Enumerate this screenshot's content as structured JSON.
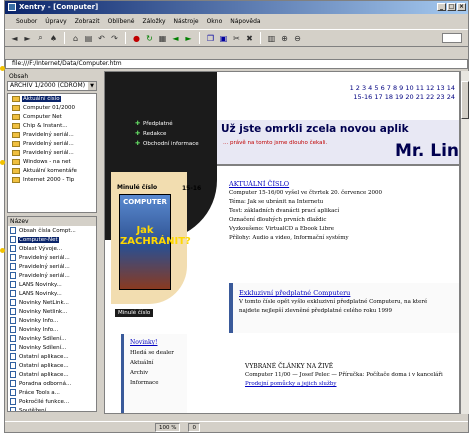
{
  "window": {
    "title": "Xentry - [Computer]",
    "buttons": [
      "_",
      "□",
      "×"
    ]
  },
  "menubar": {
    "items": [
      "Soubor",
      "Úpravy",
      "Zobrazit",
      "Oblíbené",
      "Záložky",
      "Nástroje",
      "Okno",
      "Nápověda"
    ]
  },
  "toolbar": {
    "icons": [
      {
        "name": "back-icon",
        "glyph": "◄",
        "tone": ""
      },
      {
        "name": "forward-icon",
        "glyph": "►",
        "tone": ""
      },
      {
        "name": "search-icon",
        "glyph": "⌕",
        "tone": ""
      },
      {
        "name": "binoculars-icon",
        "glyph": "♠",
        "tone": ""
      },
      {
        "name": "home-icon",
        "glyph": "⌂",
        "tone": ""
      },
      {
        "name": "folder-icon",
        "glyph": "▤",
        "tone": ""
      },
      {
        "name": "undo-icon",
        "glyph": "↶",
        "tone": ""
      },
      {
        "name": "redo-icon",
        "glyph": "↷",
        "tone": ""
      },
      {
        "name": "stop-icon",
        "glyph": "●",
        "tone": "red"
      },
      {
        "name": "refresh-icon",
        "glyph": "↻",
        "tone": "green"
      },
      {
        "name": "print-icon",
        "glyph": "▦",
        "tone": ""
      },
      {
        "name": "prev-icon",
        "glyph": "◄",
        "tone": "green"
      },
      {
        "name": "next-icon",
        "glyph": "►",
        "tone": "green"
      },
      {
        "name": "copy-icon",
        "glyph": "❐",
        "tone": "blue"
      },
      {
        "name": "paste-icon",
        "glyph": "▣",
        "tone": "blue"
      },
      {
        "name": "cut-icon",
        "glyph": "✂",
        "tone": ""
      },
      {
        "name": "delete-icon",
        "glyph": "✖",
        "tone": ""
      },
      {
        "name": "grid-icon",
        "glyph": "▥",
        "tone": ""
      },
      {
        "name": "zoom-in-icon",
        "glyph": "⊕",
        "tone": ""
      },
      {
        "name": "zoom-out-icon",
        "glyph": "⊖",
        "tone": ""
      }
    ]
  },
  "address": {
    "value": "file:///F:/Internet/Data/Computer.htm"
  },
  "sidebar": {
    "header": "Obsah",
    "combo_value": "ARCHIV 1/2000 (CDROM)",
    "combo_arrow": "▼",
    "tree": [
      {
        "label": "Aktuální číslo",
        "selected": true
      },
      {
        "label": "Computer 01/2000",
        "selected": false
      },
      {
        "label": "Computer Net",
        "selected": false
      },
      {
        "label": "Chip & Instant...",
        "selected": false
      },
      {
        "label": "Pravidelný seriál...",
        "selected": false
      },
      {
        "label": "Pravidelný seriál...",
        "selected": false
      },
      {
        "label": "Pravidelný seriál...",
        "selected": false
      },
      {
        "label": "Windows - na net",
        "selected": false
      },
      {
        "label": "Aktuální komentáře",
        "selected": false
      },
      {
        "label": "Internet 2000 - Tip",
        "selected": false
      }
    ],
    "list_header": "Název",
    "files": [
      {
        "label": "Obsah čísla Compt...",
        "selected": false
      },
      {
        "label": "Computer-Net",
        "selected": true
      },
      {
        "label": "Oblast Vývoje...",
        "selected": false
      },
      {
        "label": "Pravidelný seriál...",
        "selected": false
      },
      {
        "label": "Pravidelný seriál...",
        "selected": false
      },
      {
        "label": "Pravidelný seriál...",
        "selected": false
      },
      {
        "label": "LANS Novinky...",
        "selected": false
      },
      {
        "label": "LANS Novinky...",
        "selected": false
      },
      {
        "label": "Novinky NetLink...",
        "selected": false
      },
      {
        "label": "Novinky Netlink...",
        "selected": false
      },
      {
        "label": "Novinky Info...",
        "selected": false
      },
      {
        "label": "Novinky Info...",
        "selected": false
      },
      {
        "label": "Novinky Sdílení...",
        "selected": false
      },
      {
        "label": "Novinky Sdílení...",
        "selected": false
      },
      {
        "label": "Ostatní aplikace...",
        "selected": false
      },
      {
        "label": "Ostatní aplikace...",
        "selected": false
      },
      {
        "label": "Ostatní aplikace...",
        "selected": false
      },
      {
        "label": "Poradna odborná...",
        "selected": false
      },
      {
        "label": "Práce Tools a...",
        "selected": false
      },
      {
        "label": "Pokročilé funkce...",
        "selected": false
      },
      {
        "label": "Soutěžení...",
        "selected": false
      }
    ]
  },
  "site": {
    "nav": [
      "Předplatné",
      "Redakce",
      "Obchodní informace"
    ],
    "nav_bullet": "✚",
    "issue_numbers": [
      "1  2  3  4  5  6  7  8  9  10  11  12  13  14",
      "15-16  17  18  19  20  21  22  23  24"
    ],
    "banner_headline": "Už jste omrkli zcela novou aplik",
    "banner_sub": "... právě na tomto jsme dlouho čekali.",
    "banner_signature": "Mr. Lin",
    "cover_caption_top": "Minulé číslo",
    "cover_brand": "COMPUTER",
    "cover_head": "Jak ZACHRÁNIT?",
    "cover_caption": "Minulé číslo",
    "issue_label": "15-16",
    "current_issue": {
      "heading": "AKTUÁLNÍ ČÍSLO",
      "lines": [
        "Computer 15-16/00 vyšel ve čtvrtek 20. července 2000",
        "Téma: Jak se ubránit na Internetu",
        "Test: základních dvanácti prací aplikací",
        "Označení dlouhých prvních dlaždic",
        "Vyzkoušeno: VirtualCD a Ebook Libre",
        "Přílohy: Audio a video, Informační systémy"
      ]
    },
    "subscription": {
      "heading": "Exkluzivní předplatné Computeru",
      "lines": [
        "V tomto čísle opět vyšlo exkluzivní předplatné Computeru, na které",
        "najdete nejlepší zlevněné předplatné celého roku 1999"
      ]
    },
    "side_links": {
      "heading": "Novinky!",
      "lines": [
        "Hledá se dealer",
        "Aktuální",
        "Archiv",
        "Informace"
      ]
    },
    "selected": {
      "heading": "VYBRANÉ ČLÁNKY NA ŽIVĚ",
      "line": "Computer 11/00 — Josef Pelec — Příručka: Počítače doma i v kanceláři",
      "link": "Prodejní pomůcky a jejich služby"
    }
  },
  "status": {
    "cells": [
      "100 %",
      "0"
    ]
  }
}
